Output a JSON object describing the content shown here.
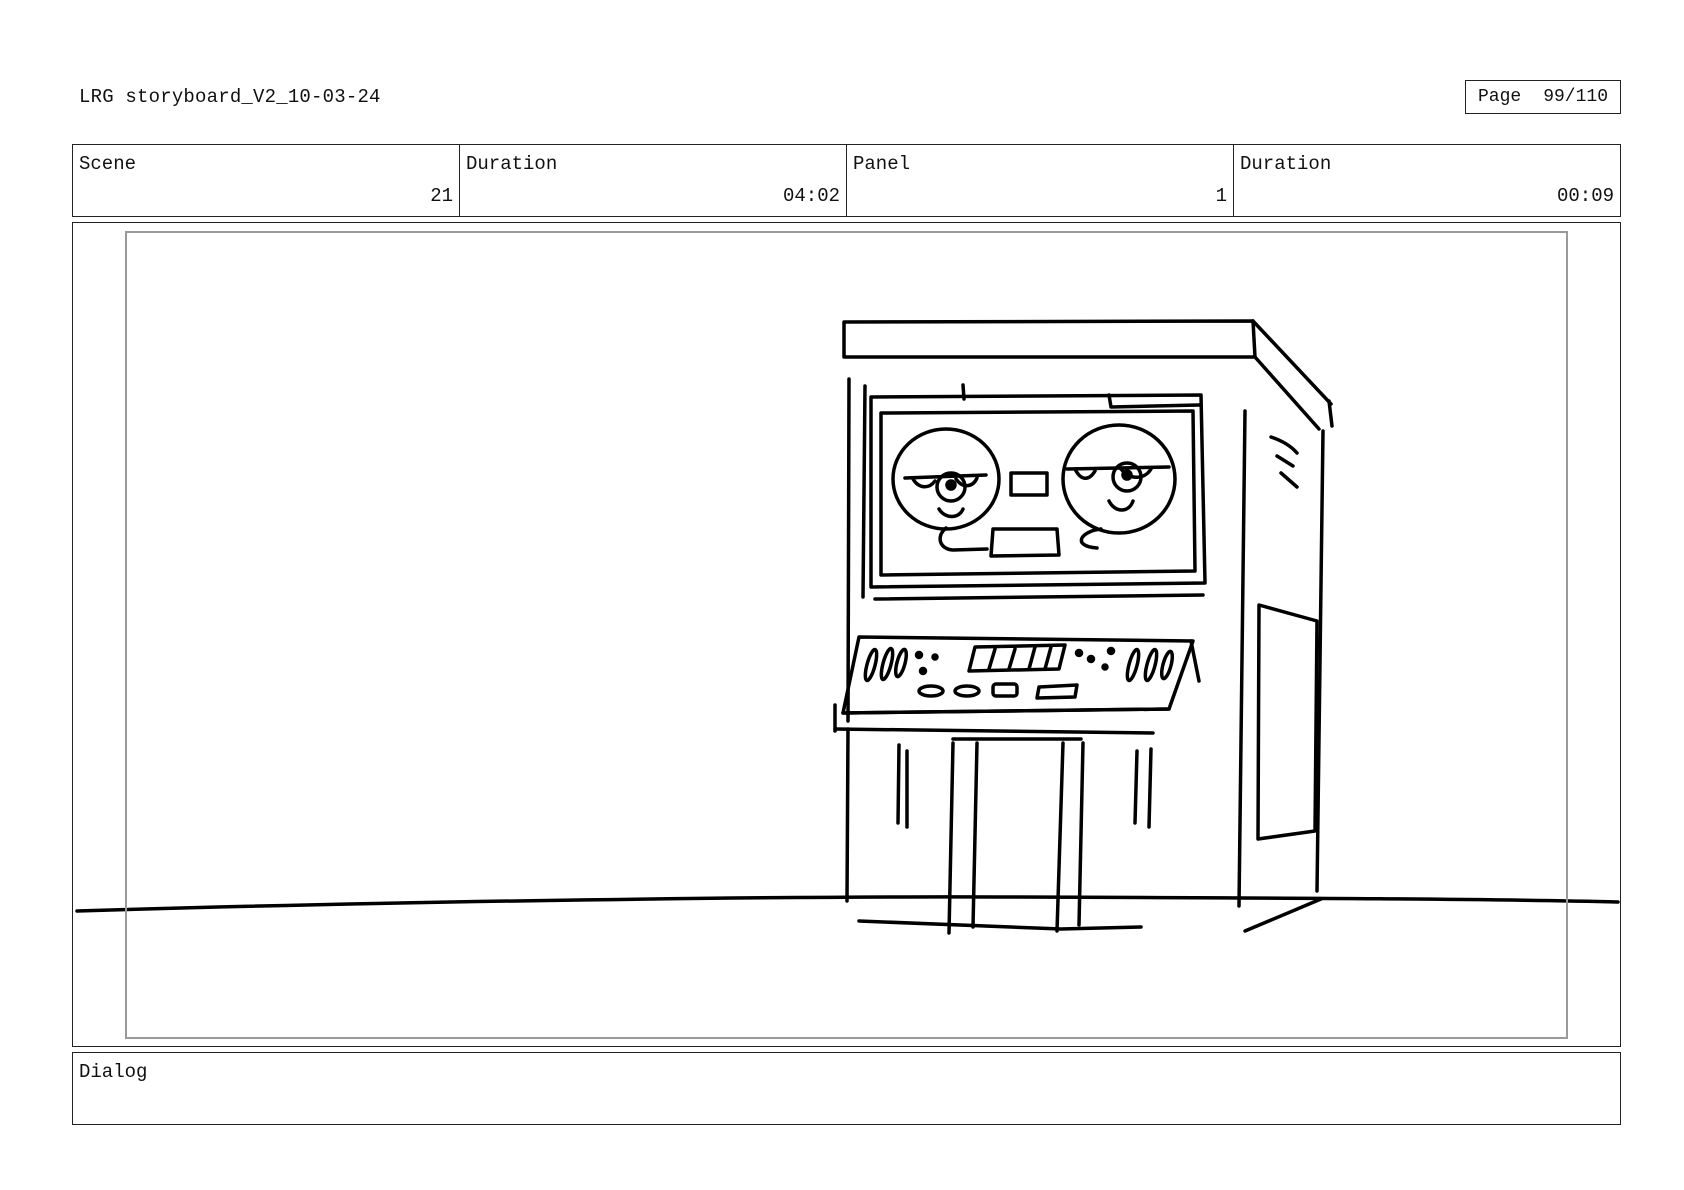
{
  "header": {
    "doc_title": "LRG storyboard_V2_10-03-24",
    "page_label": "Page",
    "page_number": "99/110"
  },
  "info": {
    "scene_label": "Scene",
    "scene_value": "21",
    "scene_duration_label": "Duration",
    "scene_duration_value": "04:02",
    "panel_label": "Panel",
    "panel_value": "1",
    "panel_duration_label": "Duration",
    "panel_duration_value": "00:09"
  },
  "panel": {
    "drawing_icon": "tape-machine-sketch-icon"
  },
  "dialog": {
    "label": "Dialog",
    "text": ""
  }
}
